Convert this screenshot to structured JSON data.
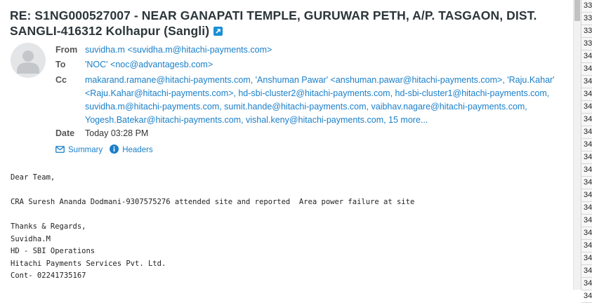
{
  "message": {
    "subject": "RE: S1NG000527007 - NEAR GANAPATI TEMPLE, GURUWAR PETH, A/P. TASGAON, DIST. SANGLI-416312 Kolhapur (Sangli)",
    "from_label": "From",
    "from_value": "suvidha.m <suvidha.m@hitachi-payments.com>",
    "to_label": "To",
    "to_value": "'NOC' <noc@advantagesb.com>",
    "cc_label": "Cc",
    "cc_line1": "makarand.ramane@hitachi-payments.com, 'Anshuman Pawar' <anshuman.pawar@hitachi-payments.com>, 'Raju.Kahar'",
    "cc_line2": "<Raju.Kahar@hitachi-payments.com>, hd-sbi-cluster2@hitachi-payments.com, hd-sbi-cluster1@hitachi-payments.com,",
    "cc_line3": "suvidha.m@hitachi-payments.com, sumit.hande@hitachi-payments.com, vaibhav.nagare@hitachi-payments.com,",
    "cc_line4": "Yogesh.Batekar@hitachi-payments.com, vishal.keny@hitachi-payments.com, 15 more...",
    "date_label": "Date",
    "date_value": "Today 03:28 PM",
    "summary_label": "Summary",
    "headers_label": "Headers",
    "body": "Dear Team,\n\nCRA Suresh Ananda Dodmani-9307575276 attended site and reported  Area power failure at site\n\nThanks & Regards,\nSuvidha.M\nHD - SBI Operations\nHitachi Payments Services Pvt. Ltd.\nCont- 02241735167"
  },
  "list_column": [
    "33",
    "33",
    "33",
    "33",
    "34",
    "34",
    "34",
    "34",
    "34",
    "34",
    "34",
    "34",
    "34",
    "34",
    "34",
    "34",
    "34",
    "34",
    "34",
    "34",
    "34",
    "34",
    "34",
    "34"
  ],
  "colors": {
    "link": "#1a7fc9",
    "subject": "#2c363a",
    "icon_blue": "#1a8fd6"
  }
}
